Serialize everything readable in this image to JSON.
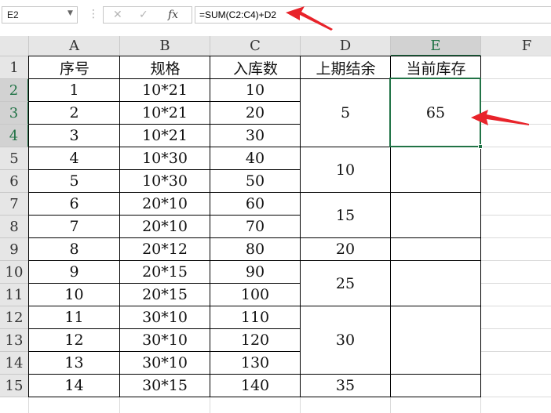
{
  "formula_bar": {
    "name_box": "E2",
    "formula": "=SUM(C2:C4)+D2",
    "cancel_icon": "✕",
    "confirm_icon": "✓",
    "function_icon": "fx",
    "separator": "⋮"
  },
  "columns": [
    "A",
    "B",
    "C",
    "D",
    "E",
    "F"
  ],
  "rows": [
    "1",
    "2",
    "3",
    "4",
    "5",
    "6",
    "7",
    "8",
    "9",
    "10",
    "11",
    "12",
    "13",
    "14",
    "15"
  ],
  "table": {
    "headers": [
      "序号",
      "规格",
      "入库数",
      "上期结余",
      "当前库存"
    ],
    "rows": [
      [
        "1",
        "10*21",
        "10"
      ],
      [
        "2",
        "10*21",
        "20"
      ],
      [
        "3",
        "10*21",
        "30"
      ],
      [
        "4",
        "10*30",
        "40"
      ],
      [
        "5",
        "10*30",
        "50"
      ],
      [
        "6",
        "20*10",
        "60"
      ],
      [
        "7",
        "20*10",
        "70"
      ],
      [
        "8",
        "20*12",
        "80"
      ],
      [
        "9",
        "20*15",
        "90"
      ],
      [
        "10",
        "20*15",
        "100"
      ],
      [
        "11",
        "30*10",
        "110"
      ],
      [
        "12",
        "30*10",
        "120"
      ],
      [
        "13",
        "30*10",
        "130"
      ],
      [
        "14",
        "30*15",
        "140"
      ]
    ],
    "d_merged": [
      {
        "rows": [
          2,
          4
        ],
        "value": "5"
      },
      {
        "rows": [
          5,
          6
        ],
        "value": "10"
      },
      {
        "rows": [
          7,
          8
        ],
        "value": "15"
      },
      {
        "rows": [
          9,
          9
        ],
        "value": "20"
      },
      {
        "rows": [
          10,
          11
        ],
        "value": "25"
      },
      {
        "rows": [
          12,
          14
        ],
        "value": "30"
      },
      {
        "rows": [
          15,
          15
        ],
        "value": "35"
      }
    ],
    "e_merged": [
      {
        "rows": [
          2,
          4
        ],
        "value": "65"
      },
      {
        "rows": [
          5,
          6
        ],
        "value": ""
      },
      {
        "rows": [
          7,
          8
        ],
        "value": ""
      },
      {
        "rows": [
          9,
          9
        ],
        "value": ""
      },
      {
        "rows": [
          10,
          11
        ],
        "value": ""
      },
      {
        "rows": [
          12,
          14
        ],
        "value": ""
      },
      {
        "rows": [
          15,
          15
        ],
        "value": ""
      }
    ]
  },
  "selected": {
    "column": "E",
    "rows": [
      "2",
      "3",
      "4"
    ]
  },
  "colors": {
    "accent": "#217346",
    "arrow": "#e8232a"
  }
}
